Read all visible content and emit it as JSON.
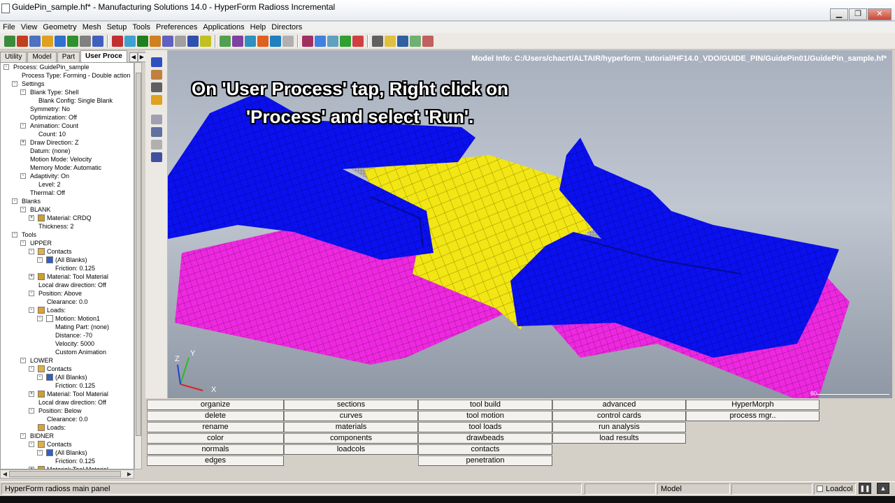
{
  "window": {
    "title": "GuidePin_sample.hf* - Manufacturing Solutions 14.0 - HyperForm Radioss Incremental",
    "minimize": "▁",
    "restore": "❐",
    "close": "✕"
  },
  "menu": [
    "File",
    "View",
    "Geometry",
    "Mesh",
    "Setup",
    "Tools",
    "Preferences",
    "Applications",
    "Help",
    "Directors"
  ],
  "tabs": [
    {
      "label": "Utility",
      "active": false
    },
    {
      "label": "Model",
      "active": false
    },
    {
      "label": "Part",
      "active": false
    },
    {
      "label": "User Proce",
      "active": true
    }
  ],
  "tab_arrows": [
    "◀",
    "▶"
  ],
  "tree": [
    {
      "label": "Process: GuidePin_sample",
      "level": 0,
      "exp": "-",
      "icon": ""
    },
    {
      "label": "Process Type: Forming - Double action",
      "level": 1,
      "exp": "",
      "icon": ""
    },
    {
      "label": "Settings",
      "level": 1,
      "exp": "-",
      "icon": ""
    },
    {
      "label": "Blank Type: Shell",
      "level": 2,
      "exp": "-",
      "icon": ""
    },
    {
      "label": "Blank Config: Single Blank",
      "level": 3,
      "exp": "",
      "icon": ""
    },
    {
      "label": "Symmetry: No",
      "level": 2,
      "exp": "",
      "icon": ""
    },
    {
      "label": "Optimization: Off",
      "level": 2,
      "exp": "",
      "icon": ""
    },
    {
      "label": "Animation: Count",
      "level": 2,
      "exp": "-",
      "icon": ""
    },
    {
      "label": "Count: 10",
      "level": 3,
      "exp": "",
      "icon": ""
    },
    {
      "label": "Draw Direction: Z",
      "level": 2,
      "exp": "+",
      "icon": ""
    },
    {
      "label": "Datum: (none)",
      "level": 2,
      "exp": "",
      "icon": ""
    },
    {
      "label": "Motion Mode: Velocity",
      "level": 2,
      "exp": "",
      "icon": ""
    },
    {
      "label": "Memory Mode: Automatic",
      "level": 2,
      "exp": "",
      "icon": ""
    },
    {
      "label": "Adaptivity: On",
      "level": 2,
      "exp": "-",
      "icon": ""
    },
    {
      "label": "Level: 2",
      "level": 3,
      "exp": "",
      "icon": ""
    },
    {
      "label": "Thermal: Off",
      "level": 2,
      "exp": "",
      "icon": ""
    },
    {
      "label": "Blanks",
      "level": 1,
      "exp": "-",
      "icon": ""
    },
    {
      "label": "BLANK",
      "level": 2,
      "exp": "-",
      "icon": ""
    },
    {
      "label": "Material: CRDQ",
      "level": 3,
      "exp": "+",
      "icon": "material"
    },
    {
      "label": "Thickness: 2",
      "level": 3,
      "exp": "",
      "icon": ""
    },
    {
      "label": "Tools",
      "level": 1,
      "exp": "-",
      "icon": ""
    },
    {
      "label": "UPPER",
      "level": 2,
      "exp": "-",
      "icon": ""
    },
    {
      "label": "Contacts",
      "level": 3,
      "exp": "-",
      "icon": "contacts"
    },
    {
      "label": "(All Blanks)",
      "level": 4,
      "exp": "-",
      "icon": "blanks"
    },
    {
      "label": "Friction: 0.125",
      "level": 5,
      "exp": "",
      "icon": ""
    },
    {
      "label": "Material: Tool Material",
      "level": 3,
      "exp": "+",
      "icon": "material"
    },
    {
      "label": "Local draw direction: Off",
      "level": 3,
      "exp": "",
      "icon": ""
    },
    {
      "label": "Position: Above",
      "level": 3,
      "exp": "-",
      "icon": ""
    },
    {
      "label": "Clearance: 0.0",
      "level": 4,
      "exp": "",
      "icon": ""
    },
    {
      "label": "Loads:",
      "level": 3,
      "exp": "-",
      "icon": "loads"
    },
    {
      "label": "Motion: Motion1",
      "level": 4,
      "exp": "-",
      "icon": "motion"
    },
    {
      "label": "Mating Part: (none)",
      "level": 5,
      "exp": "",
      "icon": ""
    },
    {
      "label": "Distance: -70",
      "level": 5,
      "exp": "",
      "icon": ""
    },
    {
      "label": "Velocity: 5000",
      "level": 5,
      "exp": "",
      "icon": ""
    },
    {
      "label": "Custom Animation",
      "level": 5,
      "exp": "",
      "icon": ""
    },
    {
      "label": "LOWER",
      "level": 2,
      "exp": "-",
      "icon": ""
    },
    {
      "label": "Contacts",
      "level": 3,
      "exp": "-",
      "icon": "contacts"
    },
    {
      "label": "(All Blanks)",
      "level": 4,
      "exp": "-",
      "icon": "blanks"
    },
    {
      "label": "Friction: 0.125",
      "level": 5,
      "exp": "",
      "icon": ""
    },
    {
      "label": "Material: Tool Material",
      "level": 3,
      "exp": "+",
      "icon": "material"
    },
    {
      "label": "Local draw direction: Off",
      "level": 3,
      "exp": "",
      "icon": ""
    },
    {
      "label": "Position: Below",
      "level": 3,
      "exp": "-",
      "icon": ""
    },
    {
      "label": "Clearance: 0.0",
      "level": 4,
      "exp": "",
      "icon": ""
    },
    {
      "label": "Loads:",
      "level": 3,
      "exp": "",
      "icon": "loads"
    },
    {
      "label": "BIDNER",
      "level": 2,
      "exp": "-",
      "icon": ""
    },
    {
      "label": "Contacts",
      "level": 3,
      "exp": "-",
      "icon": "contacts"
    },
    {
      "label": "(All Blanks)",
      "level": 4,
      "exp": "-",
      "icon": "blanks"
    },
    {
      "label": "Friction: 0.125",
      "level": 5,
      "exp": "",
      "icon": ""
    },
    {
      "label": "Material: Tool Material",
      "level": 3,
      "exp": "+",
      "icon": "material"
    }
  ],
  "viewport": {
    "model_info": "Model Info: C:/Users/chacrt/ALTAIR/hyperform_tutorial/HF14.0_VDO/GUIDE_PIN/GuidePin01/GuidePin_sample.hf*",
    "caption_line1": "On 'User Process' tap, Right click on",
    "caption_line2": "'Process' and select 'Run'.",
    "axis": {
      "x": "X",
      "y": "Y",
      "z": "Z"
    },
    "scale_label": "60",
    "colors": {
      "upper": "#0a10f0",
      "blank": "#f2e614",
      "lower": "#ee28e0",
      "grey": "#9a9a9a"
    }
  },
  "panel": {
    "columns": [
      [
        "organize",
        "delete",
        "rename",
        "color",
        "normals",
        "edges"
      ],
      [
        "sections",
        "curves",
        "materials",
        "components",
        "loadcols"
      ],
      [
        "tool build",
        "tool motion",
        "tool loads",
        "drawbeads",
        "contacts",
        "penetration"
      ],
      [
        "advanced",
        "control cards",
        "run analysis",
        "load results"
      ],
      [
        "HyperMorph",
        "process mgr.."
      ]
    ]
  },
  "status": {
    "main": "HyperForm radioss main panel",
    "model": "Model",
    "loadcol": "Loadcol",
    "empty1": "",
    "empty2": ""
  },
  "toolbar_icons": [
    "#3a8c3a",
    "#c04020",
    "#5070c0",
    "#e0a020",
    "#3070d0",
    "#309030",
    "#808080",
    "#4060c0",
    "#c03030",
    "#40a0d0",
    "#208020",
    "#d08020",
    "#6060c0",
    "#a0a0a0",
    "#3050b0",
    "#c0c020",
    "#50a050",
    "#8040a0",
    "#3090c0",
    "#e06020",
    "#2080c0",
    "#b0b0b0",
    "#a03060",
    "#4080e0",
    "#60a0c0",
    "#30a030",
    "#d04040",
    "#606060",
    "#e0c040",
    "#3060a0",
    "#70b070",
    "#c06060"
  ]
}
